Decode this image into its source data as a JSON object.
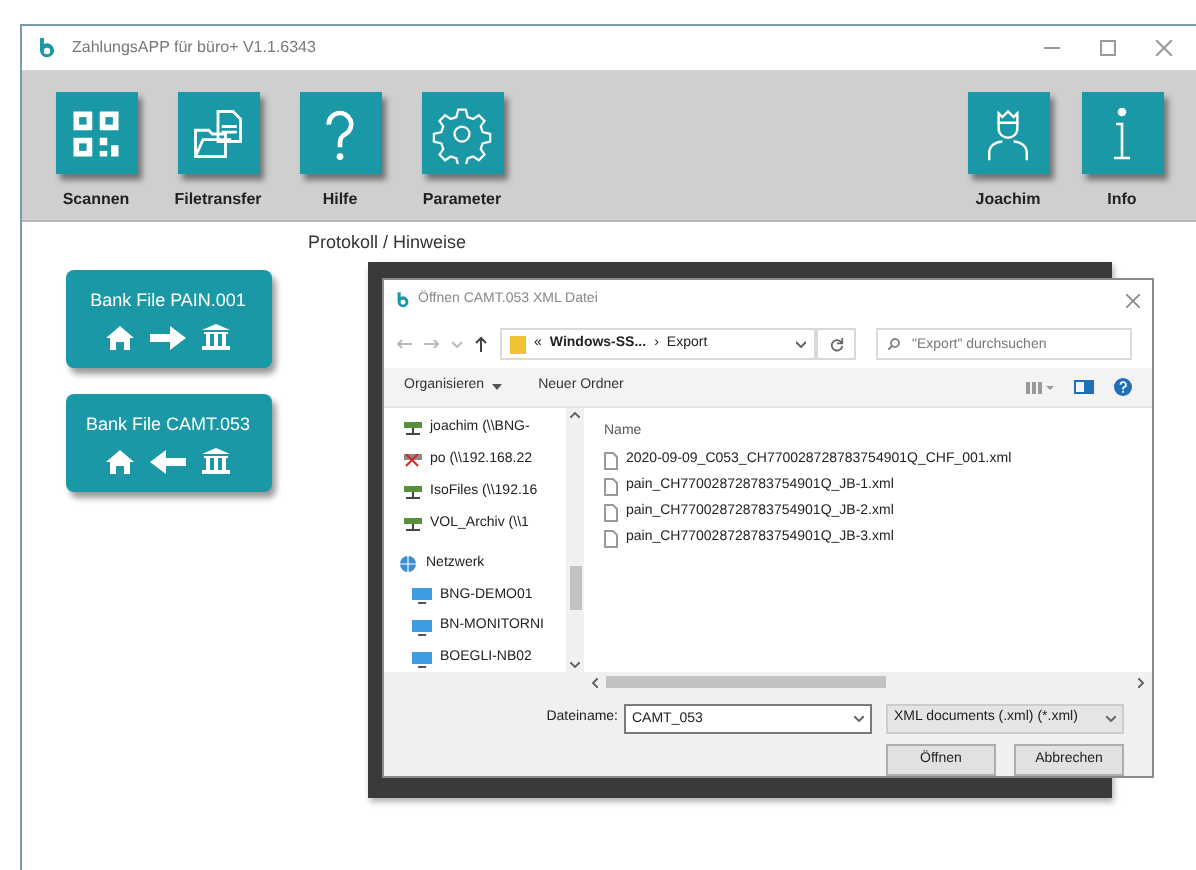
{
  "window": {
    "title": "ZahlungsAPP für büro+ V1.1.6343"
  },
  "toolbar": {
    "left": [
      {
        "label": "Scannen",
        "kind": "qr"
      },
      {
        "label": "Filetransfer",
        "kind": "files"
      },
      {
        "label": "Hilfe",
        "kind": "help"
      },
      {
        "label": "Parameter",
        "kind": "gear"
      }
    ],
    "right": [
      {
        "label": "Joachim",
        "kind": "user"
      },
      {
        "label": "Info",
        "kind": "info"
      }
    ]
  },
  "bank_buttons": [
    {
      "label": "Bank File PAIN.001",
      "kind": "export"
    },
    {
      "label": "Bank File CAMT.053",
      "kind": "import"
    }
  ],
  "log": {
    "heading": "Protokoll / Hinweise"
  },
  "dialog": {
    "title": "Öffnen CAMT.053 XML Datei",
    "path": [
      "«",
      "Windows-SS...",
      "›",
      "Export"
    ],
    "search": {
      "placeholder": "\"Export\" durchsuchen"
    },
    "commands": [
      "Organisieren",
      "Neuer Ordner"
    ],
    "nav": [
      {
        "label": "joachim (\\\\BNG-",
        "kind": "drive"
      },
      {
        "label": "po (\\\\192.168.22",
        "kind": "drive_offline"
      },
      {
        "label": "IsoFiles (\\\\192.16",
        "kind": "drive"
      },
      {
        "label": "VOL_Archiv (\\\\1",
        "kind": "drive"
      },
      {
        "label": "Netzwerk",
        "kind": "network",
        "children": [
          {
            "label": "BNG-DEMO01",
            "kind": "computer"
          },
          {
            "label": "BN-MONITORNI",
            "kind": "computer"
          },
          {
            "label": "BOEGLI-NB02",
            "kind": "computer"
          }
        ]
      }
    ],
    "column": "Name",
    "files": [
      "2020-09-09_C053_CH770028728783754901Q_CHF_001.xml",
      "pain_CH770028728783754901Q_JB-1.xml",
      "pain_CH770028728783754901Q_JB-2.xml",
      "pain_CH770028728783754901Q_JB-3.xml"
    ],
    "filename": {
      "label": "Dateiname:",
      "value": "CAMT_053"
    },
    "filetype": "XML documents (.xml) (*.xml)",
    "buttons": [
      "Öffnen",
      "Abbrechen"
    ]
  }
}
